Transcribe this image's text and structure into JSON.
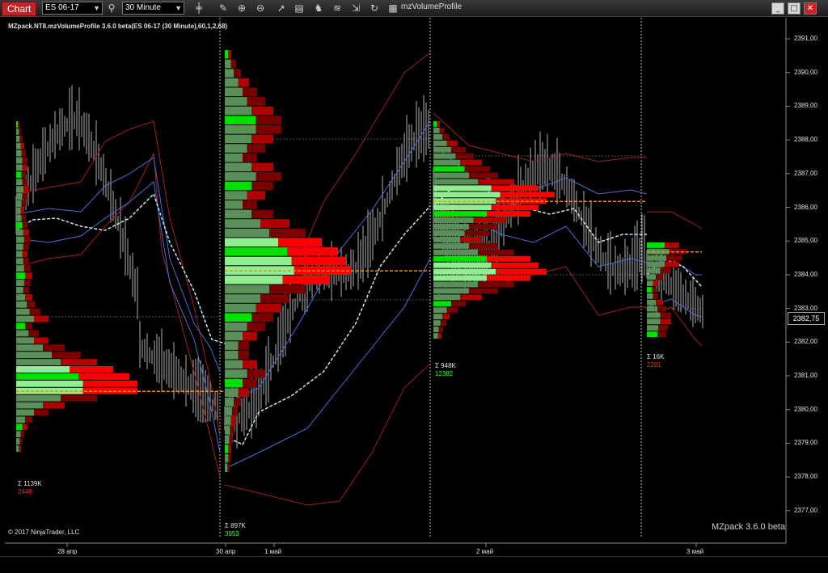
{
  "toolbar": {
    "chart_tab": "Chart",
    "instrument": "ES 06-17",
    "timeframe": "30 Minute",
    "indicator_label": "mzVolumeProfile",
    "icons": [
      "search-icon",
      "bar-type-icon",
      "draw-icon",
      "zoom-in-icon",
      "zoom-out-icon",
      "pointer-icon",
      "data-box-icon",
      "strategies-icon",
      "indicators-icon",
      "properties-icon",
      "reload-icon",
      "grid-icon"
    ]
  },
  "window_buttons": {
    "minimize": "_",
    "maximize": "□",
    "close": "✕"
  },
  "chart": {
    "indicator_title": "MZpack.NT8.mzVolumeProfile 3.6.0 beta(ES 06-17 (30 Minute),60,1,2,68)",
    "copyright": "© 2017 NinjaTrader, LLC",
    "watermark": "MZpack 3.6.0 beta",
    "current_price": "2382,75",
    "y_axis_ticks": [
      "2391,00",
      "2390,00",
      "2389,00",
      "2388,00",
      "2387,00",
      "2386,00",
      "2385,00",
      "2384,00",
      "2383,00",
      "2382,00",
      "2381,00",
      "2380,00",
      "2379,00",
      "2378,00",
      "2377,00"
    ],
    "x_axis_ticks": [
      "28 апр",
      "30 апр",
      "1 май",
      "2 май",
      "3 май"
    ],
    "profiles": [
      {
        "volume": "Σ 1139K",
        "delta": "2448",
        "delta_color": "#ff2020"
      },
      {
        "volume": "Σ 897K",
        "delta": "3953",
        "delta_color": "#30ff30"
      },
      {
        "volume": "Σ 948K",
        "delta": "12382",
        "delta_color": "#30ff30"
      },
      {
        "volume": "Σ 16K",
        "delta": "2281",
        "delta_color": "#ff2020"
      }
    ]
  },
  "colors": {
    "background": "#000000",
    "bid_bar": "#ff0000",
    "ask_bar": "#90ee90",
    "poc_line": "#ff8c00",
    "vwap": "#c8e6f0",
    "band_inner": "#4a6fd6",
    "band_outer": "#a02020",
    "candle": "#b0b0b0"
  }
}
